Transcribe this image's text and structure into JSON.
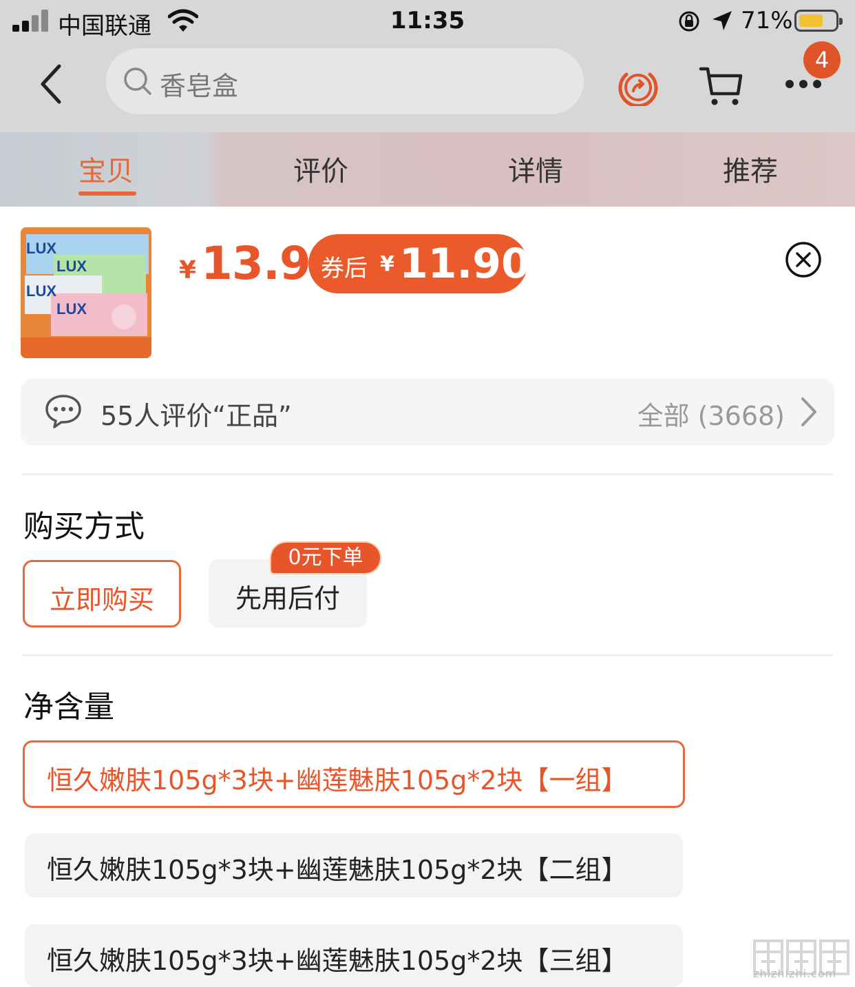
{
  "status_bar": {
    "carrier": "中国联通",
    "time": "11:35",
    "battery_percent": "71%"
  },
  "nav": {
    "search_placeholder": "香皂盒",
    "cart_badge_count": "4"
  },
  "tabs": [
    {
      "label": "宝贝",
      "active": true
    },
    {
      "label": "评价",
      "active": false
    },
    {
      "label": "详情",
      "active": false
    },
    {
      "label": "推荐",
      "active": false
    }
  ],
  "product": {
    "thumbnail_brand": "LUX",
    "price_symbol": "¥",
    "price": "13.9",
    "coupon_label": "券后",
    "coupon_symbol": "¥",
    "coupon_price": "11.90"
  },
  "review_summary": {
    "text": "55人评价“正品”",
    "all_label": "全部 (3668)"
  },
  "purchase_method": {
    "title": "购买方式",
    "options": [
      {
        "label": "立即购买",
        "selected": true
      },
      {
        "label": "先用后付",
        "selected": false,
        "tag": "0元下单"
      }
    ]
  },
  "net_content": {
    "title": "净含量",
    "options": [
      {
        "label": "恒久嫩肤105g*3块+幽莲魅肤105g*2块【一组】",
        "selected": true
      },
      {
        "label": "恒久嫩肤105g*3块+幽莲魅肤105g*2块【二组】",
        "selected": false
      },
      {
        "label": "恒久嫩肤105g*3块+幽莲魅肤105g*2块【三组】",
        "selected": false
      }
    ]
  },
  "watermark": {
    "url": "zhizhizhi.com"
  },
  "colors": {
    "accent": "#e8552a",
    "dim_background": "#d7d7d7",
    "option_background": "#f3f3f3"
  }
}
